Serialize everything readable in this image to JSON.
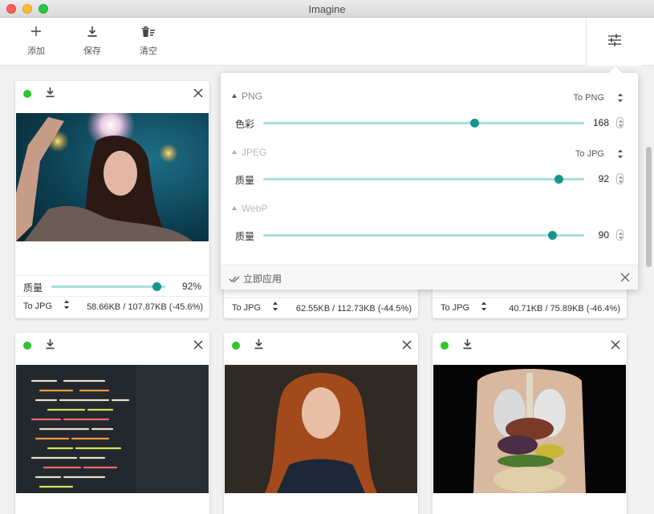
{
  "window": {
    "title": "Imagine"
  },
  "toolbar": {
    "add_label": "添加",
    "save_label": "保存",
    "clear_label": "清空"
  },
  "cards": [
    {
      "quality_label": "质量",
      "quality_value": "92%",
      "quality_level": 0.92,
      "format": "To JPG",
      "size": "58.66KB / 107.87KB (-45.6%)",
      "image": "woman-sparkler-photo"
    },
    {
      "format": "To JPG",
      "size": "62.55KB / 112.73KB (-44.5%)"
    },
    {
      "format": "To JPG",
      "size": "40.71KB / 75.89KB (-46.4%)"
    },
    {
      "image": "code-screen-photo"
    },
    {
      "image": "red-hair-woman-photo"
    },
    {
      "image": "anatomy-model-photo"
    }
  ],
  "settings": {
    "png": {
      "heading": "PNG",
      "target": "To PNG",
      "label": "色彩",
      "value": "168",
      "max": 256
    },
    "jpeg": {
      "heading": "JPEG",
      "target": "To JPG",
      "label": "质量",
      "value": "92",
      "max": 100
    },
    "webp": {
      "heading": "WebP",
      "label": "质量",
      "value": "90",
      "max": 100
    },
    "apply_label": "立即应用"
  },
  "colors": {
    "accent": "#159588",
    "track": "#a7dfdb",
    "status_ok": "#2dc52d"
  }
}
